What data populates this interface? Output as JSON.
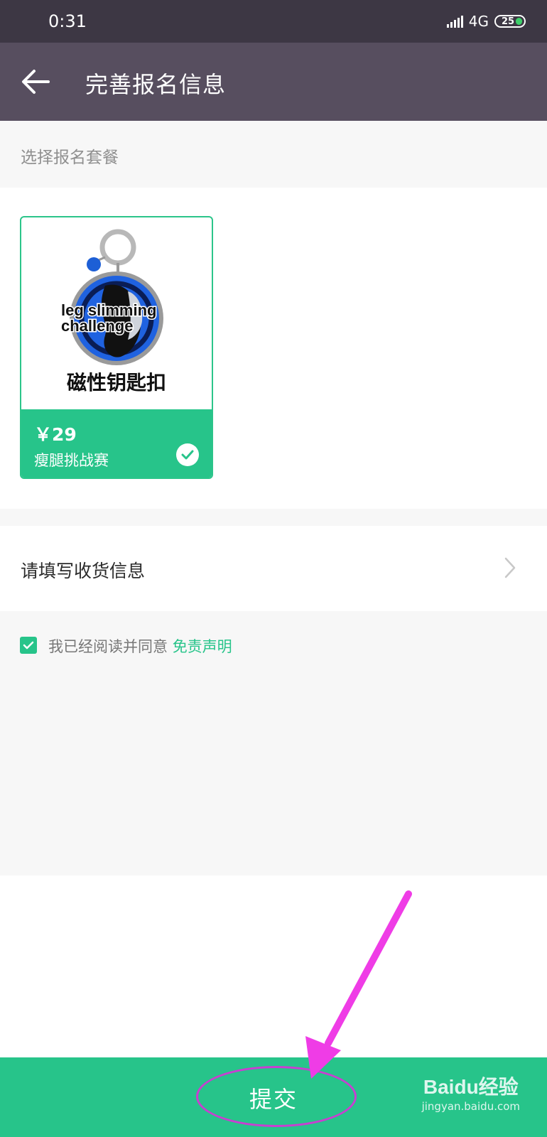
{
  "status_bar": {
    "time": "0:31",
    "network": "4G",
    "battery": "25"
  },
  "app_bar": {
    "title": "完善报名信息"
  },
  "package_section": {
    "label": "选择报名套餐",
    "card": {
      "image_text_line1": "leg slimming",
      "image_text_line2": "challenge",
      "image_caption": "磁性钥匙扣",
      "price": "￥29",
      "name": "瘦腿挑战赛",
      "selected": true
    }
  },
  "address": {
    "label": "请填写收货信息"
  },
  "agreement": {
    "text": "我已经阅读并同意",
    "link": "免责声明",
    "checked": true
  },
  "submit": {
    "label": "提交"
  },
  "watermark": {
    "logo": "Baidu经验",
    "sub": "jingyan.baidu.com"
  },
  "colors": {
    "accent": "#27c48a",
    "app_bar": "#574e5f",
    "status_bar": "#3d3744",
    "annotation": "#e83ce0"
  }
}
